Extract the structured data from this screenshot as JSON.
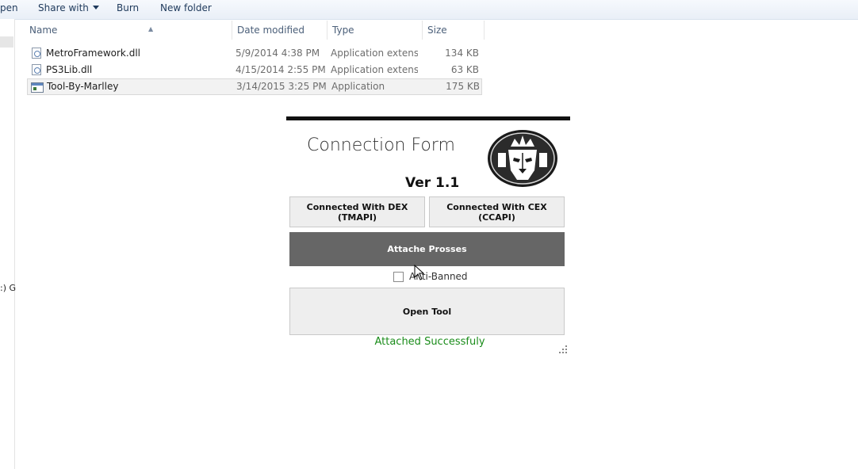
{
  "toolbar": {
    "open_partial": "pen",
    "share_with": "Share with",
    "burn": "Burn",
    "new_folder": "New folder"
  },
  "navpane": {
    "partial_text": ":) G"
  },
  "columns": {
    "name": "Name",
    "date": "Date modified",
    "type": "Type",
    "size": "Size"
  },
  "files": [
    {
      "name": "MetroFramework.dll",
      "date": "5/9/2014 4:38 PM",
      "type": "Application extens...",
      "size": "134 KB",
      "icon": "dll-file-icon"
    },
    {
      "name": "PS3Lib.dll",
      "date": "4/15/2014 2:55 PM",
      "type": "Application extens...",
      "size": "63 KB",
      "icon": "dll-file-icon"
    },
    {
      "name": "Tool-By-Marlley",
      "date": "3/14/2015 3:25 PM",
      "type": "Application",
      "size": "175 KB",
      "icon": "application-icon",
      "selected": true
    }
  ],
  "form": {
    "title": "Connection Form",
    "version": "Ver 1.1",
    "dex_button": "Connected With DEX (TMAPI)",
    "cex_button": "Connected With CEX (CCAPI)",
    "attach_button": "Attache Prosses",
    "anti_banned_label": "Anti-Banned",
    "anti_banned_checked": false,
    "open_tool_button": "Open Tool",
    "status": "Attached Successfuly",
    "logo": "lion-crown-logo"
  },
  "colors": {
    "status_green": "#1a8c1a",
    "attach_button_bg": "#666666",
    "top_bar": "#111111"
  }
}
